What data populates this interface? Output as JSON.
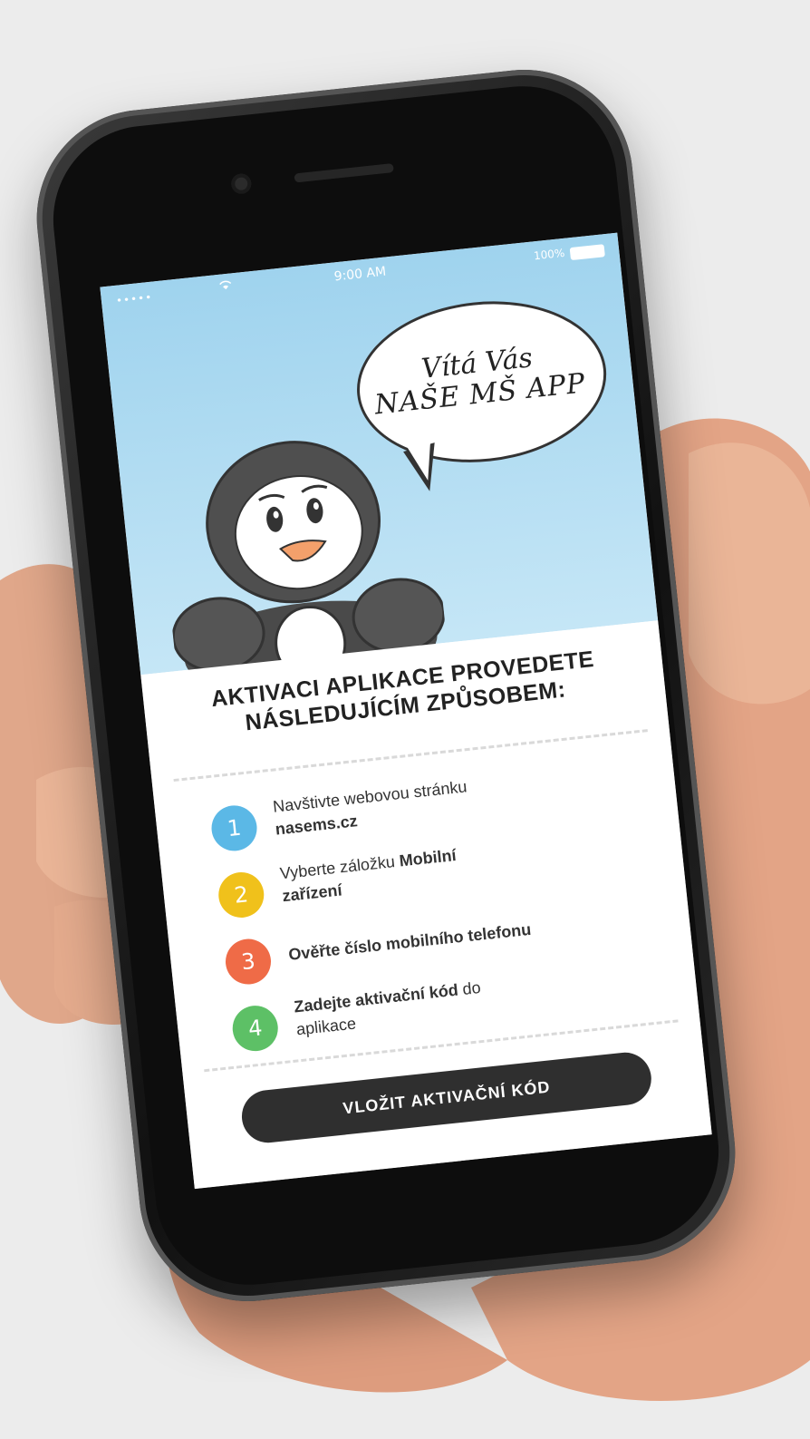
{
  "status_bar": {
    "signal": "•••••",
    "time": "9:00 AM",
    "battery_percent": "100%"
  },
  "welcome": {
    "line1": "Vítá Vás",
    "line2": "NAŠE MŠ APP"
  },
  "heading": {
    "line1": "AKTIVACI APLIKACE PROVEDETE",
    "line2": "NÁSLEDUJÍCÍM ZPŮSOBEM:"
  },
  "steps": [
    {
      "number": "1",
      "text_a": "Navštivte webovou stránku",
      "bold_a": "",
      "text_b": "",
      "bold_b": "nasems.cz",
      "color": "#5bb8e6"
    },
    {
      "number": "2",
      "text_a": "Vyberte záložku ",
      "bold_a": "Mobilní",
      "text_b": "",
      "bold_b": "zařízení",
      "color": "#f0c11b"
    },
    {
      "number": "3",
      "text_a": "",
      "bold_a": "Ověřte číslo mobilního telefonu",
      "text_b": "",
      "bold_b": "",
      "color": "#ef6b47"
    },
    {
      "number": "4",
      "text_a": "",
      "bold_a": "Zadejte aktivační kód",
      "text_a2": " do",
      "text_b": "aplikace",
      "bold_b": "",
      "color": "#5dc066"
    }
  ],
  "button": {
    "label": "VLOŽIT AKTIVAČNÍ KÓD"
  }
}
